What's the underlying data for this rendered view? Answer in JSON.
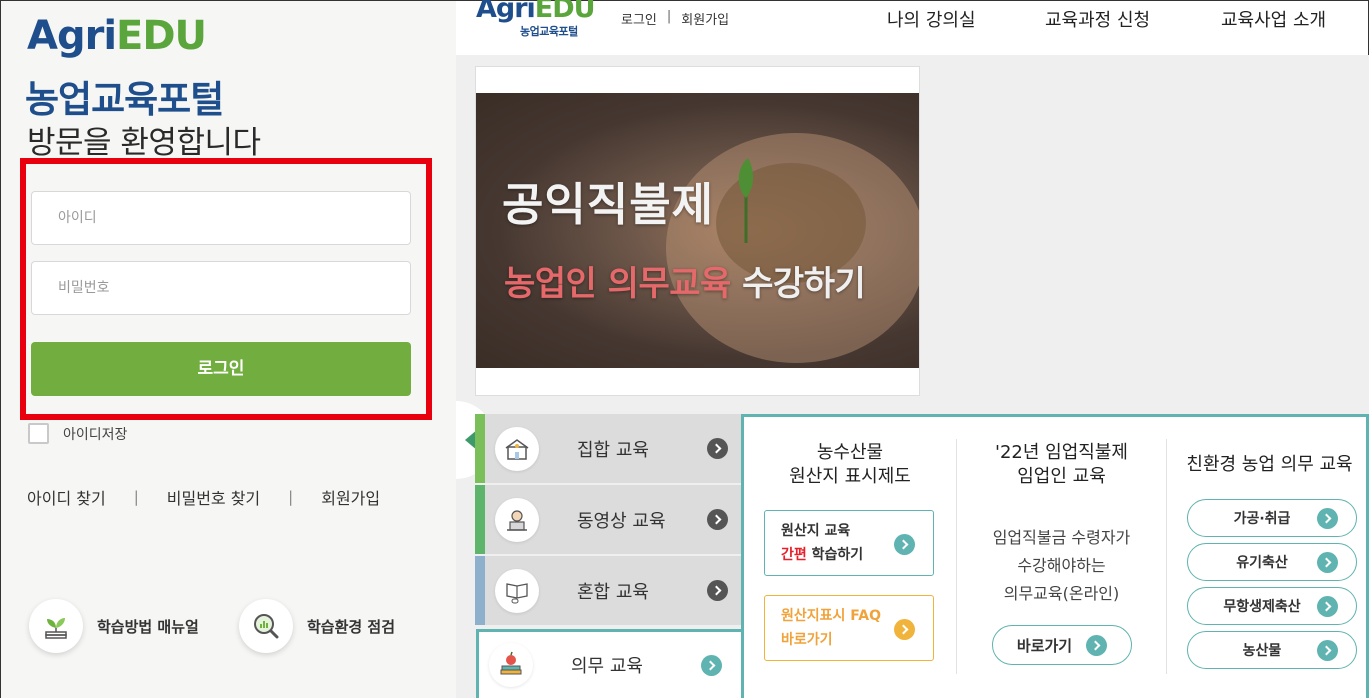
{
  "colors": {
    "brand_blue": "#1f4e8c",
    "brand_green": "#5aa53c",
    "login_green": "#72ad3f",
    "highlight_red": "#e8000e",
    "teal": "#5fb3b0",
    "orange": "#f0b43c"
  },
  "login_panel": {
    "logo_agri": "Agri",
    "logo_edu": "EDU",
    "portal_title": "농업교육포털",
    "welcome": "방문을 환영합니다",
    "id_placeholder": "아이디",
    "pw_placeholder": "비밀번호",
    "login_button": "로그인",
    "save_id_label": "아이디저장",
    "find_id": "아이디 찾기",
    "find_pw": "비밀번호 찾기",
    "signup": "회원가입",
    "sep": "|",
    "quick_manual": "학습방법 매뉴얼",
    "quick_env": "학습환경 점검"
  },
  "header": {
    "logo_agri": "Agri",
    "logo_edu": "EDU",
    "logo_sub": "농업교육포털",
    "login": "로그인",
    "sep": "|",
    "signup": "회원가입",
    "nav": {
      "my_lectures": "나의 강의실",
      "course_apply": "교육과정 신청",
      "program_intro": "교육사업 소개"
    }
  },
  "banner": {
    "title": "공익직불제",
    "sub_highlight": "농업인 의무교육",
    "sub_rest": " 수강하기"
  },
  "edu_menu": {
    "group": "집합 교육",
    "video": "동영상 교육",
    "mixed": "혼합 교육",
    "mandatory": "의무 교육"
  },
  "info_panel": {
    "col1": {
      "title_line1": "농수산물",
      "title_line2": "원산지 표시제도",
      "card1_line1": "원산지 교육",
      "card1_red": "간편",
      "card1_line2_rest": " 학습하기",
      "card2_line1": "원산지표시 FAQ",
      "card2_line2": "바로가기"
    },
    "col2": {
      "title_line1": "'22년 임업직불제",
      "title_line2": "임업인 교육",
      "desc_line1": "임업직불금 수령자가",
      "desc_line2": "수강해야하는",
      "desc_line3": "의무교육(온라인)",
      "button": "바로가기"
    },
    "col3": {
      "title": "친환경 농업 의무 교육",
      "categories": [
        "가공·취급",
        "유기축산",
        "무항생제축산",
        "농산물"
      ]
    }
  }
}
